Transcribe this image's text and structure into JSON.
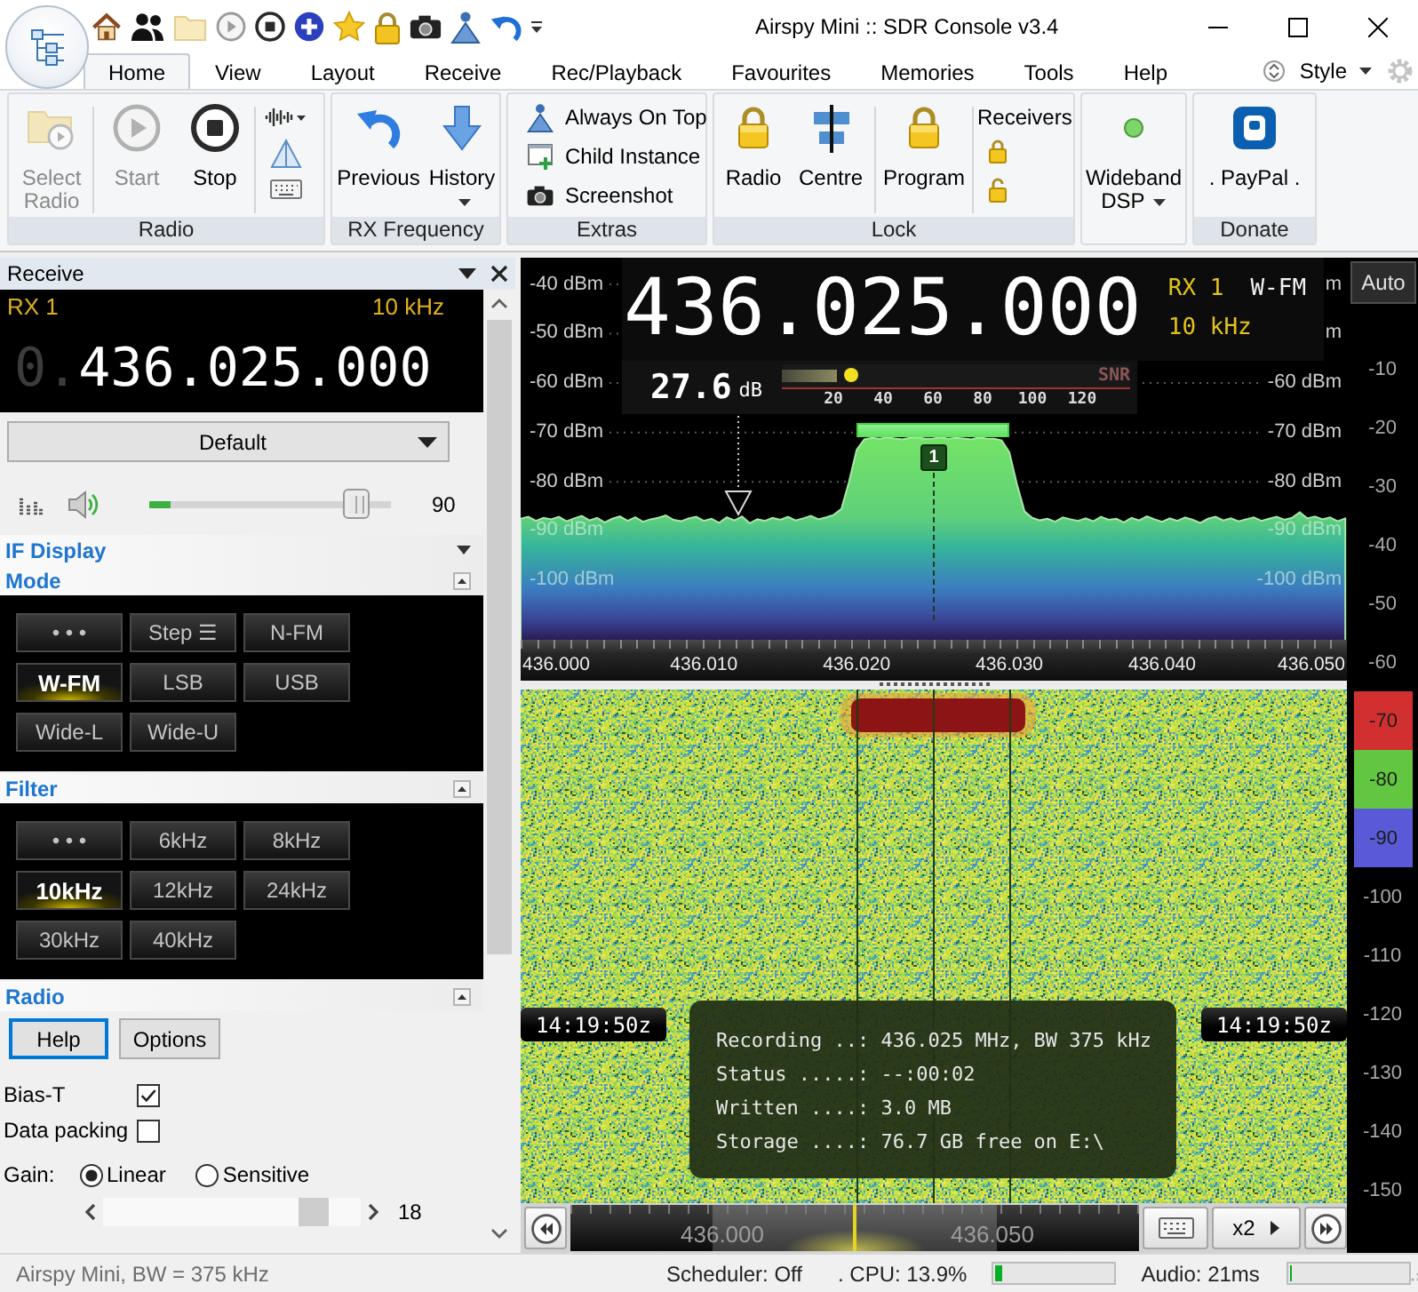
{
  "window": {
    "title": "Airspy Mini :: SDR Console v3.4"
  },
  "ribbon_tabs": [
    {
      "label": "Home",
      "selected": true
    },
    {
      "label": "View",
      "selected": false
    },
    {
      "label": "Layout",
      "selected": false
    },
    {
      "label": "Receive",
      "selected": false
    },
    {
      "label": "Rec/Playback",
      "selected": false
    },
    {
      "label": "Favourites",
      "selected": false
    },
    {
      "label": "Memories",
      "selected": false
    },
    {
      "label": "Tools",
      "selected": false
    },
    {
      "label": "Help",
      "selected": false
    }
  ],
  "style_menu": {
    "label": "Style"
  },
  "ribbon_groups": [
    {
      "title": "Radio",
      "items": [
        {
          "kind": "large",
          "label": "Select Radio",
          "disabled": true,
          "dropdown": false
        },
        {
          "kind": "large",
          "label": "Start",
          "disabled": true,
          "dropdown": false
        },
        {
          "kind": "large",
          "label": "Stop",
          "disabled": false,
          "dropdown": false
        },
        {
          "kind": "icon_stack"
        }
      ]
    },
    {
      "title": "RX Frequency",
      "items": [
        {
          "kind": "large",
          "label": "Previous",
          "disabled": false,
          "dropdown": false
        },
        {
          "kind": "large",
          "label": "History",
          "disabled": false,
          "dropdown": true
        }
      ]
    },
    {
      "title": "Extras",
      "items": [
        {
          "kind": "small_list",
          "entries": [
            "Always On Top",
            "Child Instance",
            "Screenshot"
          ]
        }
      ]
    },
    {
      "title": "Lock",
      "items": [
        {
          "kind": "large",
          "label": "Radio",
          "disabled": false,
          "dropdown": false
        },
        {
          "kind": "large",
          "label": "Centre",
          "disabled": false,
          "dropdown": false
        },
        {
          "kind": "large",
          "label": "Program",
          "disabled": false,
          "dropdown": false
        },
        {
          "kind": "lock_list",
          "label": "Receivers"
        }
      ]
    },
    {
      "items": [
        {
          "kind": "status",
          "label": "Wideband DSP",
          "on": true,
          "dropdown": true
        }
      ]
    },
    {
      "title": "Donate",
      "items": [
        {
          "kind": "large",
          "label": ". PayPal .",
          "disabled": false,
          "dropdown": false
        }
      ]
    }
  ],
  "receive_panel": {
    "title": "Receive",
    "rx_label": "RX 1",
    "step": "10 kHz",
    "frequency_prefix": "0.",
    "frequency": "436.025.000",
    "preset": "Default",
    "volume": {
      "level": 0.9,
      "reading": "90",
      "meter": {
        "level": 0.09
      }
    },
    "sections": [
      {
        "title": "IF Display",
        "expanded": false
      },
      {
        "kind": "grid",
        "title": "Mode",
        "expanded": true,
        "buttons": [
          {
            "label": "• • •",
            "selected": false
          },
          {
            "label": "Step ☰",
            "selected": false
          },
          {
            "label": "N-FM",
            "selected": false
          },
          {
            "label": "W-FM",
            "selected": true
          },
          {
            "label": "LSB",
            "selected": false
          },
          {
            "label": "USB",
            "selected": false
          },
          {
            "label": "Wide-L",
            "selected": false
          },
          {
            "label": "Wide-U",
            "selected": false
          }
        ]
      },
      {
        "kind": "grid",
        "title": "Filter",
        "expanded": true,
        "buttons": [
          {
            "label": "• • •",
            "selected": false
          },
          {
            "label": "6kHz",
            "selected": false
          },
          {
            "label": "8kHz",
            "selected": false
          },
          {
            "label": "10kHz",
            "selected": true
          },
          {
            "label": "12kHz",
            "selected": false
          },
          {
            "label": "24kHz",
            "selected": false
          },
          {
            "label": "30kHz",
            "selected": false
          },
          {
            "label": "40kHz",
            "selected": false
          }
        ]
      },
      {
        "kind": "settings",
        "title": "Radio",
        "expanded": true,
        "buttons": [
          {
            "label": "Help",
            "focused": true
          },
          {
            "label": "Options",
            "focused": false
          }
        ],
        "checkboxes": [
          {
            "label": "Bias-T",
            "checked": true
          },
          {
            "label": "Data packing",
            "checked": false
          }
        ],
        "gain": {
          "label": "Gain:",
          "options": [
            {
              "label": "Linear",
              "selected": true
            },
            {
              "label": "Sensitive",
              "selected": false
            }
          ],
          "slider": {
            "level": 0.86,
            "reading": "18"
          }
        }
      }
    ]
  },
  "spectrum": {
    "frequency": "436.025.000",
    "rx_label": "RX 1",
    "mode": "W-FM",
    "bandwidth": "10 kHz",
    "snr": {
      "reading": "27.6",
      "unit": "dB",
      "label": "SNR",
      "level": 0.2,
      "scale": [
        "20",
        "40",
        "60",
        "80",
        "100",
        "120"
      ]
    },
    "levels_right": [
      "m",
      "m",
      "-60 dBm",
      "-70 dBm",
      "-80 dBm",
      "-90 dBm",
      "-100 dBm"
    ],
    "receiver_badge": "1",
    "chart_data": {
      "type": "area",
      "x": [
        435.998,
        435.9985,
        435.999,
        435.9995,
        436.0,
        436.0005,
        436.001,
        436.0015,
        436.002,
        436.0025,
        436.003,
        436.0035,
        436.004,
        436.0045,
        436.005,
        436.0055,
        436.006,
        436.0065,
        436.007,
        436.0075,
        436.008,
        436.0085,
        436.009,
        436.0095,
        436.01,
        436.0105,
        436.011,
        436.0115,
        436.012,
        436.0125,
        436.013,
        436.0135,
        436.014,
        436.0145,
        436.015,
        436.0155,
        436.016,
        436.0165,
        436.017,
        436.0175,
        436.018,
        436.0185,
        436.019,
        436.0195,
        436.02,
        436.0205,
        436.021,
        436.0215,
        436.022,
        436.0225,
        436.023,
        436.0235,
        436.024,
        436.0245,
        436.025,
        436.0255,
        436.026,
        436.0265,
        436.027,
        436.0275,
        436.028,
        436.0285,
        436.029,
        436.0295,
        436.03,
        436.0305,
        436.031,
        436.0315,
        436.032,
        436.0325,
        436.033,
        436.0335,
        436.034,
        436.0345,
        436.035,
        436.0355,
        436.036,
        436.0365,
        436.037,
        436.0375,
        436.038,
        436.0385,
        436.039,
        436.0395,
        436.04,
        436.0405,
        436.041,
        436.0415,
        436.042,
        436.0425,
        436.043,
        436.0435,
        436.044,
        436.0445,
        436.045,
        436.0455,
        436.046,
        436.0465,
        436.047,
        436.0475,
        436.048,
        436.0485,
        436.049,
        436.0495,
        436.05,
        436.0505,
        436.051,
        436.0515,
        436.052
      ],
      "series": [
        {
          "color": "#a8e6a8",
          "values": [
            -87.5,
            -87.1,
            -87.9,
            -87.3,
            -87.6,
            -87.1,
            -88.0,
            -87.4,
            -86.9,
            -87.8,
            -87.3,
            -88.2,
            -87.5,
            -87.0,
            -87.9,
            -87.2,
            -88.1,
            -87.6,
            -87.3,
            -86.8,
            -87.7,
            -88.0,
            -87.4,
            -87.1,
            -87.9,
            -87.5,
            -88.3,
            -87.2,
            -87.8,
            -87.0,
            -88.4,
            -87.6,
            -87.9,
            -87.3,
            -87.7,
            -87.1,
            -87.8,
            -87.4,
            -86.9,
            -87.6,
            -87.2,
            -86.7,
            -85.5,
            -80.0,
            -73.5,
            -71.4,
            -71.1,
            -71.3,
            -71.0,
            -71.2,
            -71.4,
            -71.1,
            -71.0,
            -71.3,
            -71.2,
            -71.0,
            -71.3,
            -71.1,
            -71.2,
            -71.4,
            -71.0,
            -71.2,
            -71.3,
            -71.6,
            -74.0,
            -80.5,
            -86.0,
            -87.3,
            -87.8,
            -87.5,
            -88.1,
            -87.2,
            -87.6,
            -87.9,
            -87.4,
            -88.0,
            -87.1,
            -87.7,
            -87.5,
            -88.2,
            -87.3,
            -87.8,
            -87.0,
            -87.6,
            -88.1,
            -87.4,
            -87.9,
            -87.2,
            -87.7,
            -88.3,
            -87.5,
            -87.1,
            -87.8,
            -87.4,
            -88.0,
            -87.6,
            -87.2,
            -87.9,
            -87.5,
            -87.1,
            -87.7,
            -87.3,
            -86.2,
            -87.4,
            -87.0,
            -87.6,
            -87.2,
            -88.0,
            -87.4
          ]
        }
      ],
      "xlim": [
        435.998,
        436.0521
      ],
      "ylim": [
        -112,
        -34.6
      ],
      "grid": true,
      "xticks": [
        {
          "value": 436.0,
          "label": "436.000"
        },
        {
          "value": 436.01,
          "label": "436.010"
        },
        {
          "value": 436.02,
          "label": "436.020"
        },
        {
          "value": 436.03,
          "label": "436.030"
        },
        {
          "value": 436.04,
          "label": "436.040"
        },
        {
          "value": 436.05,
          "label": "436.050"
        }
      ],
      "yticks": [
        {
          "value": -40,
          "label": "-40 dBm"
        },
        {
          "value": -50,
          "label": "-50 dBm"
        },
        {
          "value": -60,
          "label": "-60 dBm"
        },
        {
          "value": -70,
          "label": "-70 dBm"
        },
        {
          "value": -80,
          "label": "-80 dBm"
        },
        {
          "value": -90,
          "label": "-90 dBm"
        },
        {
          "value": -100,
          "label": "-100 dBm"
        }
      ]
    }
  },
  "waterfall": {
    "timestamps": [
      "14:19:50z",
      "14:19:50z"
    ],
    "recording_info": [
      "Recording ..: 436.025 MHz, BW 375 kHz",
      "Status .....: --:00:02",
      "Written ....: 3.0 MB",
      "Storage ....: 76.7 GB free on E:\\"
    ]
  },
  "tuning_strip": {
    "labels": [
      "436.000",
      "436.050"
    ],
    "zoom": "x2"
  },
  "level_scale": {
    "button": "Auto",
    "ticks_upper": [
      "-10",
      "-20",
      "-30",
      "-40",
      "-50",
      "-60"
    ],
    "colour_bands": [
      {
        "label": "-70",
        "color": "#d23030"
      },
      {
        "label": "-80",
        "color": "#62c640"
      },
      {
        "label": "-90",
        "color": "#5a5ad8"
      }
    ],
    "ticks_lower": [
      "-100",
      "-110",
      "-120",
      "-130",
      "-140",
      "-150"
    ]
  },
  "status_bar": {
    "device": "Airspy Mini, BW = 375 kHz",
    "scheduler": "Scheduler: Off",
    "cpu": {
      "label": ". CPU: 13.9%",
      "level": 0.06
    },
    "audio": {
      "label": "Audio: 21ms",
      "level": 0.015
    }
  }
}
